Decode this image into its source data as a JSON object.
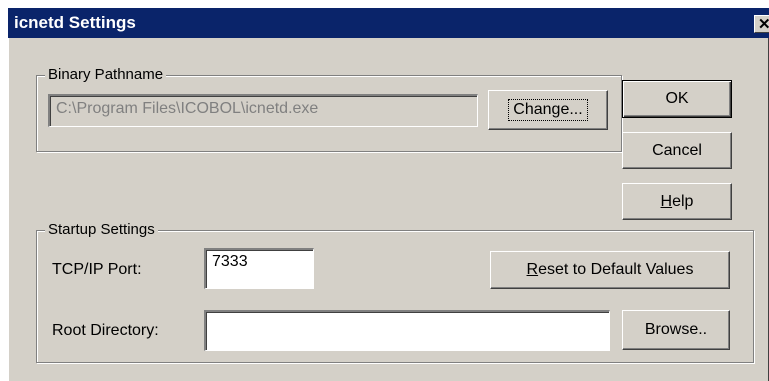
{
  "window": {
    "title": "icnetd Settings",
    "close_glyph": "✕"
  },
  "binary_group": {
    "legend": "Binary Pathname",
    "path_value": "C:\\Program Files\\ICOBOL\\icnetd.exe",
    "change_label": "Change..."
  },
  "buttons": {
    "ok": "OK",
    "cancel": "Cancel",
    "help_mnemonic": "H",
    "help_rest": "elp"
  },
  "startup_group": {
    "legend": "Startup Settings",
    "port_label": "TCP/IP Port:",
    "port_value": "7333",
    "reset_mnemonic": "R",
    "reset_rest": "eset to Default Values",
    "root_label": "Root Directory:",
    "root_value": "",
    "browse_label": "Browse.."
  },
  "colors": {
    "titlebar": "#0a246a",
    "face": "#d4d0c8"
  }
}
